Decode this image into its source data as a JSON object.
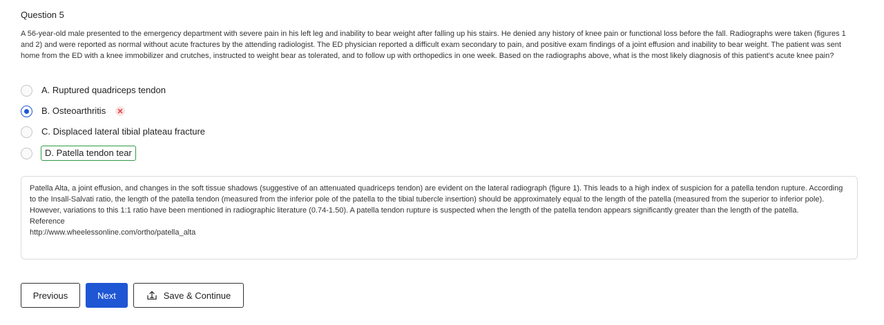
{
  "question": {
    "title": "Question 5",
    "text": "A 56-year-old male presented to the emergency department with severe pain in his left leg and inability to bear weight after falling up his stairs. He denied any history of knee pain or functional loss before the fall. Radiographs were taken (figures 1 and 2) and were reported as normal without acute fractures by the attending radiologist. The ED physician reported a difficult exam secondary to pain, and positive exam findings of a joint effusion and inability to bear weight. The patient was sent home from the ED with a knee immobilizer and crutches, instructed to weight bear as tolerated, and to follow up with orthopedics in one week. Based on the radiographs above, what is the most likely diagnosis of this patient's acute knee pain?"
  },
  "options": [
    {
      "label": "A. Ruptured quadriceps tendon",
      "selected": false,
      "correct": false
    },
    {
      "label": "B. Osteoarthritis",
      "selected": true,
      "correct": false,
      "marked_wrong": true
    },
    {
      "label": "C. Displaced lateral tibial plateau fracture",
      "selected": false,
      "correct": false
    },
    {
      "label": "D. Patella tendon tear",
      "selected": false,
      "correct": true
    }
  ],
  "explanation": {
    "text": "Patella Alta, a joint effusion, and changes in the soft tissue shadows (suggestive of an attenuated quadriceps tendon) are evident on the lateral radiograph (figure 1). This leads to a high index of suspicion for a patella tendon rupture. According to the Insall-Salvati ratio, the length of the patella tendon (measured from the inferior pole of the patella to the tibial tubercle insertion) should be approximately equal to the length of the patella (measured from the superior to inferior pole). However, variations to this 1:1 ratio have been mentioned in radiographic literature (0.74-1.50). A patella tendon rupture is suspected when the length of the patella tendon appears significantly greater than the length of the patella.",
    "reference_label": "Reference",
    "reference_url": "http://www.wheelessonline.com/ortho/patella_alta"
  },
  "buttons": {
    "previous": "Previous",
    "next": "Next",
    "save": "Save & Continue",
    "save_icon": "save-upload-icon"
  },
  "colors": {
    "primary": "#1f56d4",
    "correct_outline": "#2e9b45",
    "wrong_mark": "#e04a4a"
  }
}
